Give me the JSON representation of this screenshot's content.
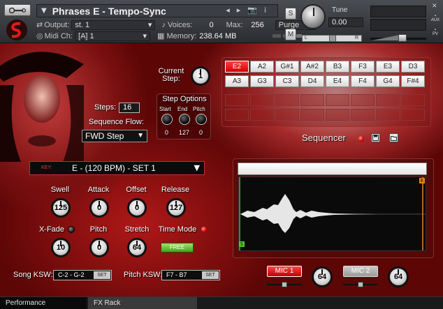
{
  "header": {
    "instrument_name": "Phrases E - Tempo-Sync",
    "output_label": "Output:",
    "output_value": "st. 1",
    "voices_label": "Voices:",
    "voices_value": "0",
    "max_label": "Max:",
    "max_value": "256",
    "purge_label": "Purge",
    "midi_label": "Midi Ch:",
    "midi_value": "[A] 1",
    "memory_label": "Memory:",
    "memory_value": "238.64 MB",
    "solo_label": "S",
    "mute_label": "M",
    "tune_label": "Tune",
    "tune_value": "0.00",
    "pan_left": "L",
    "pan_right": "R",
    "aux_label": "AUX",
    "pv_label": "PV"
  },
  "sequencer": {
    "current_step_label": "Current Step:",
    "current_step_value": "1",
    "steps_label": "Steps:",
    "steps_value": "16",
    "sequence_flow_label": "Sequence Flow:",
    "sequence_flow_value": "FWD Step",
    "step_options_title": "Step Options",
    "start_label": "Start",
    "end_label": "End",
    "pitch_label": "Pitch",
    "start_value": "0",
    "end_value": "127",
    "pitch_value": "0",
    "title": "Sequencer",
    "row1": [
      "E2",
      "A2",
      "G#1",
      "A#2",
      "B3",
      "F3",
      "E3",
      "D3"
    ],
    "row2": [
      "A3",
      "G3",
      "C3",
      "D4",
      "E4",
      "F4",
      "G4",
      "F#4"
    ],
    "active_index": 0
  },
  "controls": {
    "key_tag": "KEY:",
    "key_value": "E - (120 BPM) - SET 1",
    "swell_label": "Swell",
    "swell_value": "125",
    "attack_label": "Attack",
    "attack_value": "0",
    "offset_label": "Offset",
    "offset_value": "0",
    "release_label": "Release",
    "release_value": "127",
    "xfade_label": "X-Fade",
    "xfade_value": "10",
    "pitch_label": "Pitch",
    "pitch_value": "0",
    "stretch_label": "Stretch",
    "stretch_value": "64",
    "timemode_label": "Time Mode",
    "free_label": "FREE",
    "song_ksw_label": "Song KSW:",
    "song_ksw_value": "C-2 - G-2",
    "pitch_ksw_label": "Pitch KSW:",
    "pitch_ksw_value": "F7 - B7",
    "set_label": "SET"
  },
  "waveform": {
    "end_marker": "E",
    "start_marker": "S"
  },
  "mics": {
    "mic1_label": "MIC 1",
    "mic1_value": "64",
    "mic2_label": "MIC 2",
    "mic2_value": "64"
  },
  "tabs": {
    "performance": "Performance",
    "fx_rack": "FX Rack"
  },
  "colors": {
    "accent_red": "#d40000",
    "free_green": "#5cc22a"
  }
}
